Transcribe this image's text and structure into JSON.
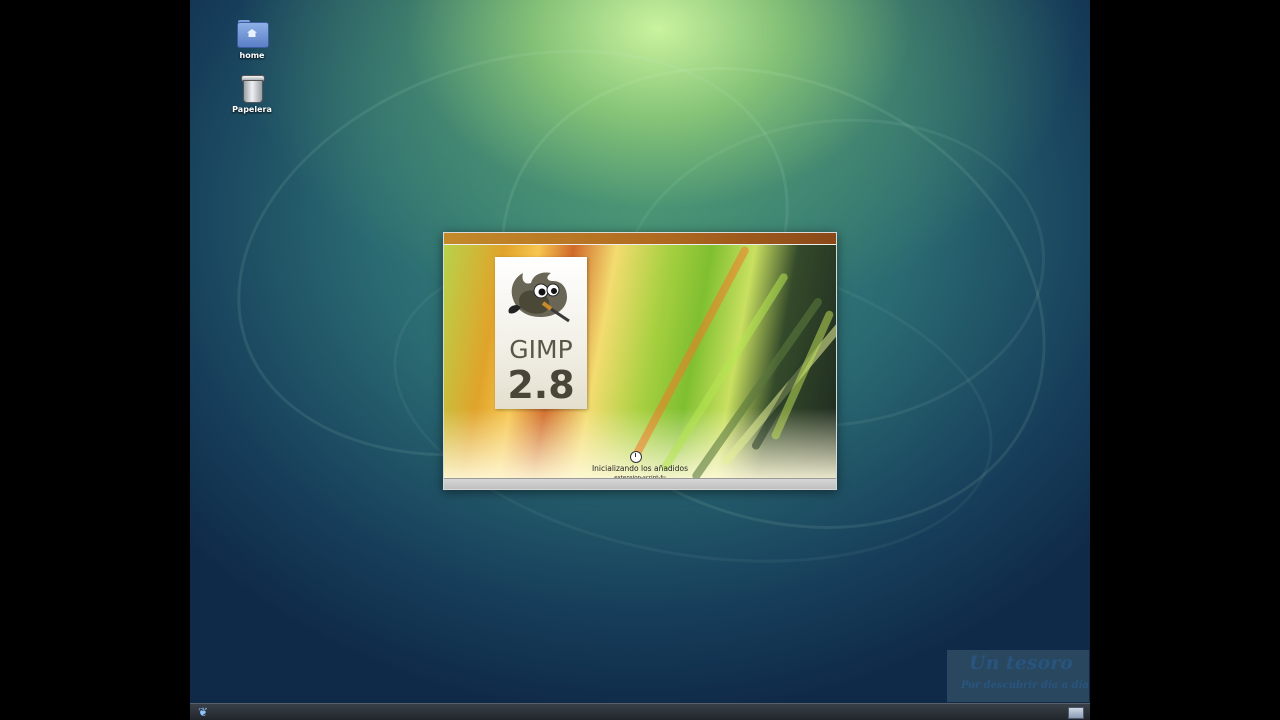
{
  "desktop": {
    "icons": [
      {
        "label": "home",
        "icon": "home-folder-icon"
      },
      {
        "label": "Papelera",
        "icon": "trash-icon"
      }
    ]
  },
  "splash": {
    "app_name": "GIMP",
    "version": "2.8",
    "status": "Inicializando los añadidos",
    "detail": "extension-script-fu",
    "progress": 0.0,
    "topbar_color": "#c48a2a"
  },
  "watermark": {
    "title": "Un tesoro",
    "subtitle": "Por descubrir día a día"
  },
  "taskbar": {
    "menu_icon": "xfce-menu-icon",
    "tray_icon": "show-desktop-icon"
  }
}
